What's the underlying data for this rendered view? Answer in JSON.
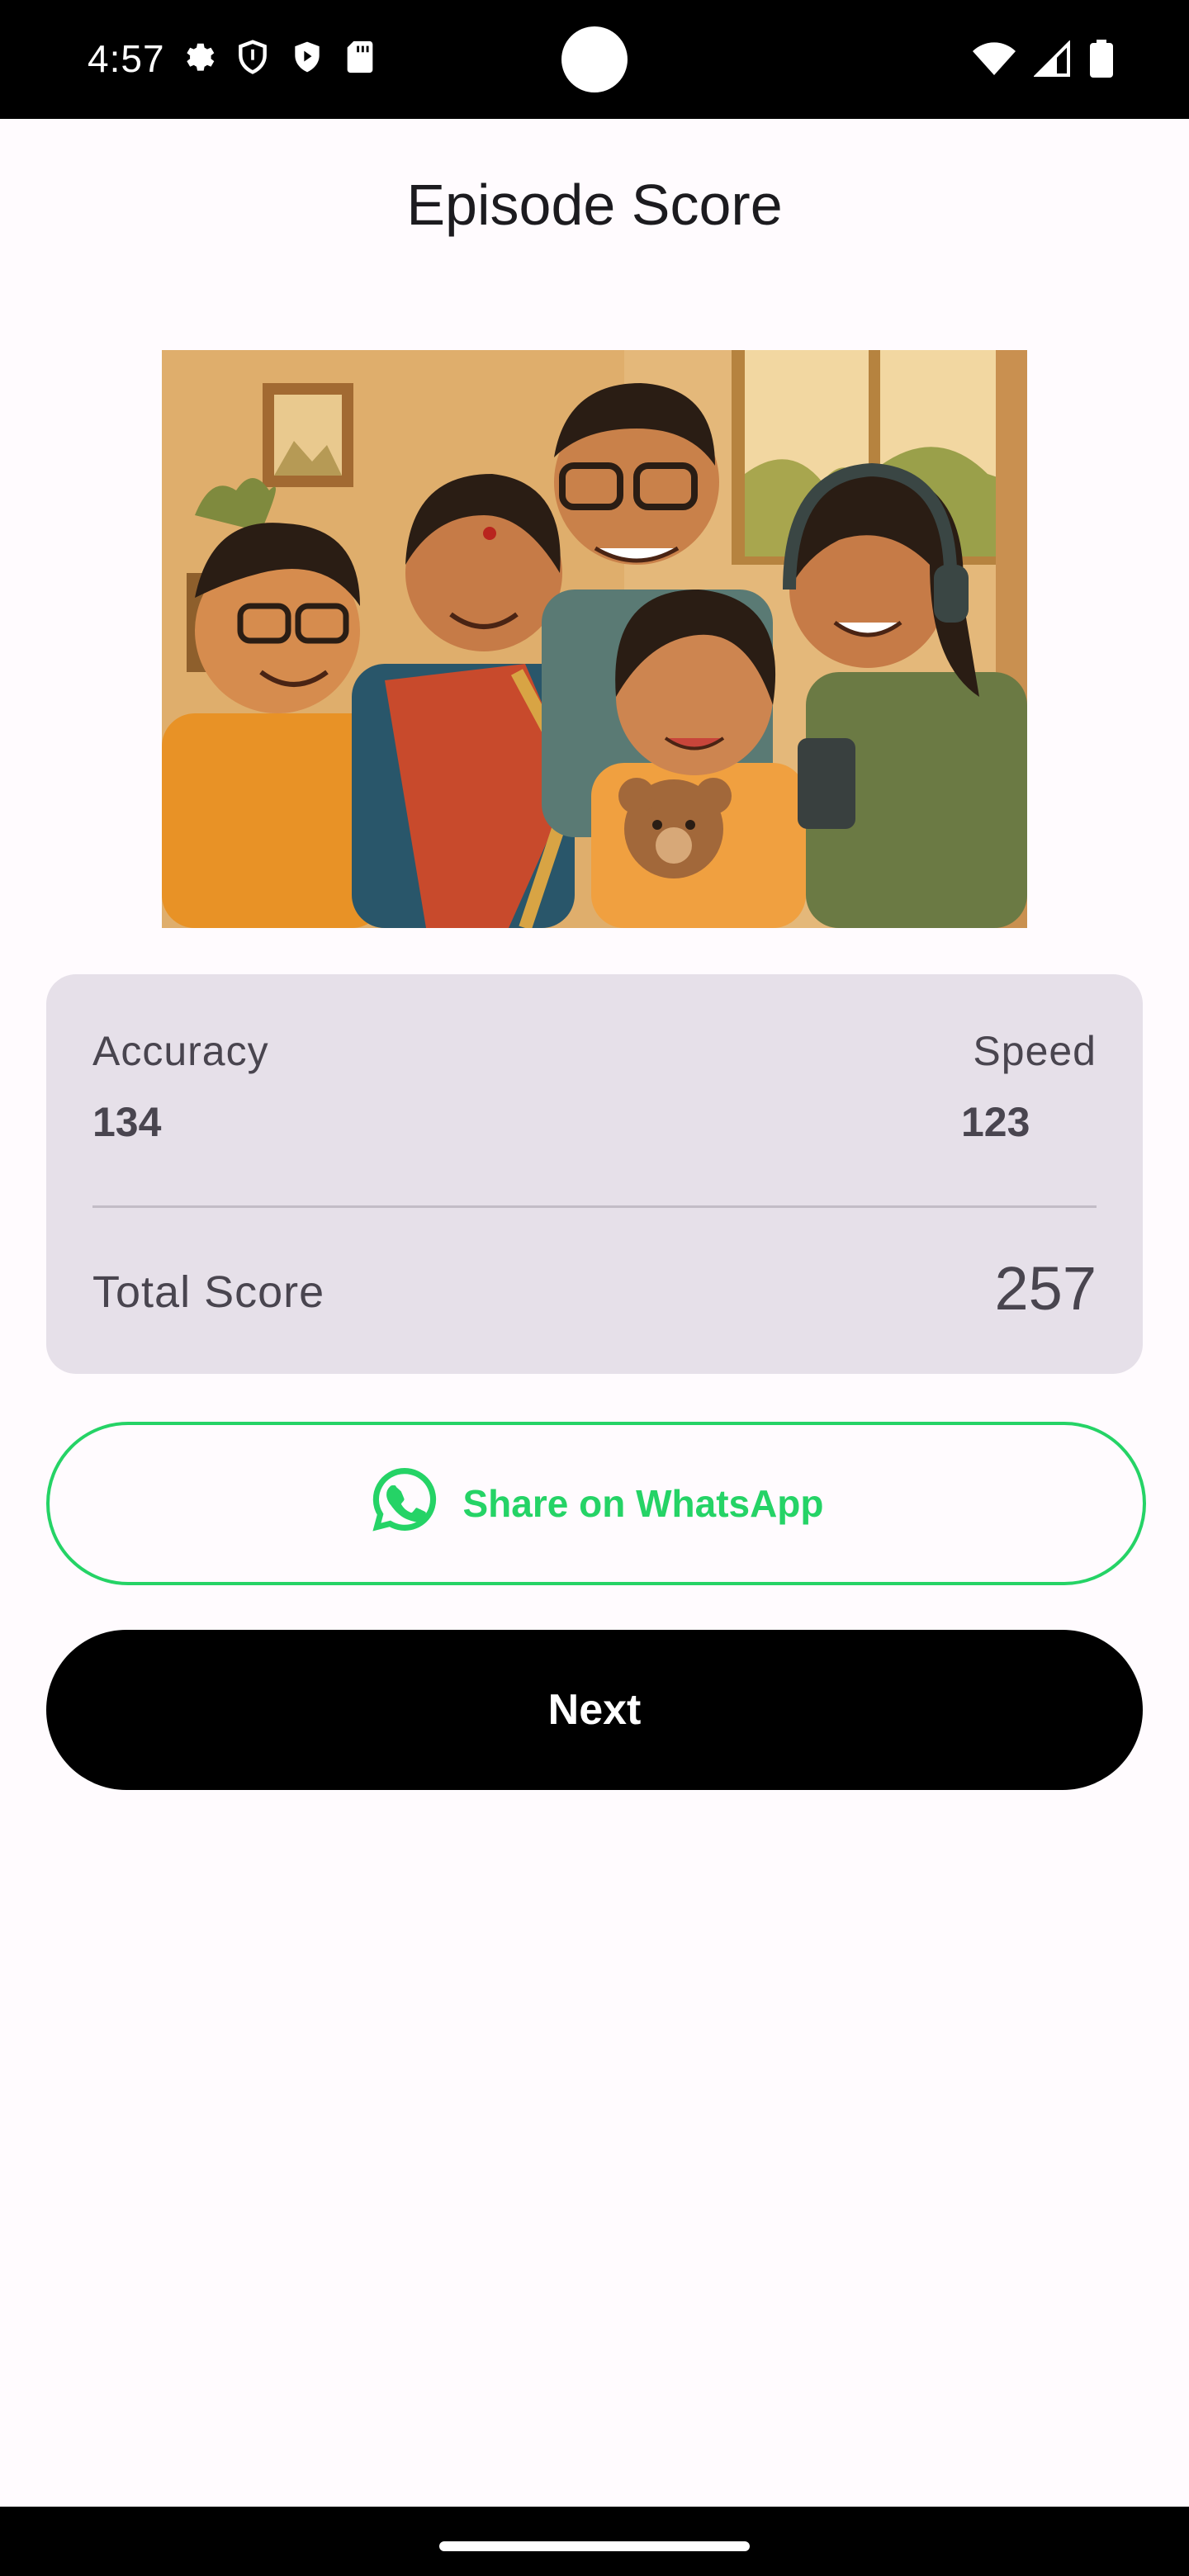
{
  "status_bar": {
    "time": "4:57",
    "left_icons": [
      "gear-icon",
      "shield-icon",
      "play-shield-icon",
      "sd-card-icon"
    ],
    "right_icons": [
      "wifi-icon",
      "signal-icon",
      "battery-icon"
    ]
  },
  "page": {
    "title": "Episode Score"
  },
  "hero_image": {
    "description_icon": "family-illustration"
  },
  "score_card": {
    "accuracy_label": "Accuracy",
    "accuracy_value": "134",
    "speed_label": "Speed",
    "speed_value": "123",
    "total_label": "Total Score",
    "total_value": "257"
  },
  "actions": {
    "share_label": "Share on WhatsApp",
    "share_color": "#25d366",
    "next_label": "Next"
  },
  "colors": {
    "background": "#fffbfe",
    "card": "#e6e0e9",
    "text": "#49454f",
    "primary_button": "#000000"
  }
}
